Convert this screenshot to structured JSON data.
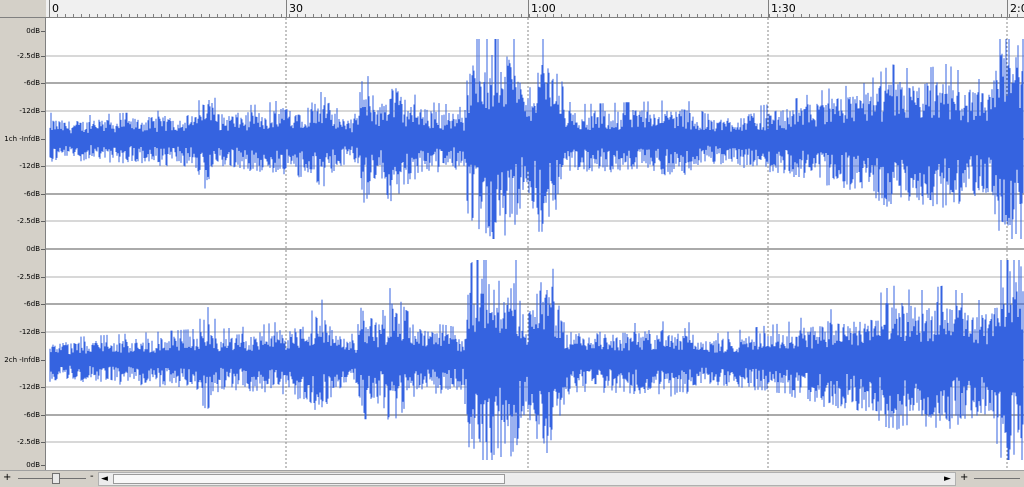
{
  "timeline": {
    "labels": [
      "0",
      "30",
      "1:00",
      "1:30",
      "2:0"
    ]
  },
  "channels": [
    {
      "name": "1ch",
      "scale_labels": [
        "0dB",
        "-2.5dB",
        "-6dB",
        "-12dB",
        "1ch -InfdB",
        "-12dB",
        "-6dB",
        "-2.5dB"
      ]
    },
    {
      "name": "2ch",
      "scale_labels": [
        "0dB",
        "-2.5dB",
        "-6dB",
        "-12dB",
        "2ch -InfdB",
        "-12dB",
        "-6dB",
        "-2.5dB",
        "0dB"
      ]
    }
  ],
  "waveform": {
    "color": "#3563e0",
    "gridline_color": "#555555",
    "dotted_line_color": "#888888"
  },
  "statusbar": {
    "zoom_in_label": "+",
    "zoom_out_label": "-",
    "scroll_left_arrow": "◄",
    "scroll_right_arrow": "►",
    "right_zoom_out_label": "+",
    "right_zoom_minus": "-"
  }
}
